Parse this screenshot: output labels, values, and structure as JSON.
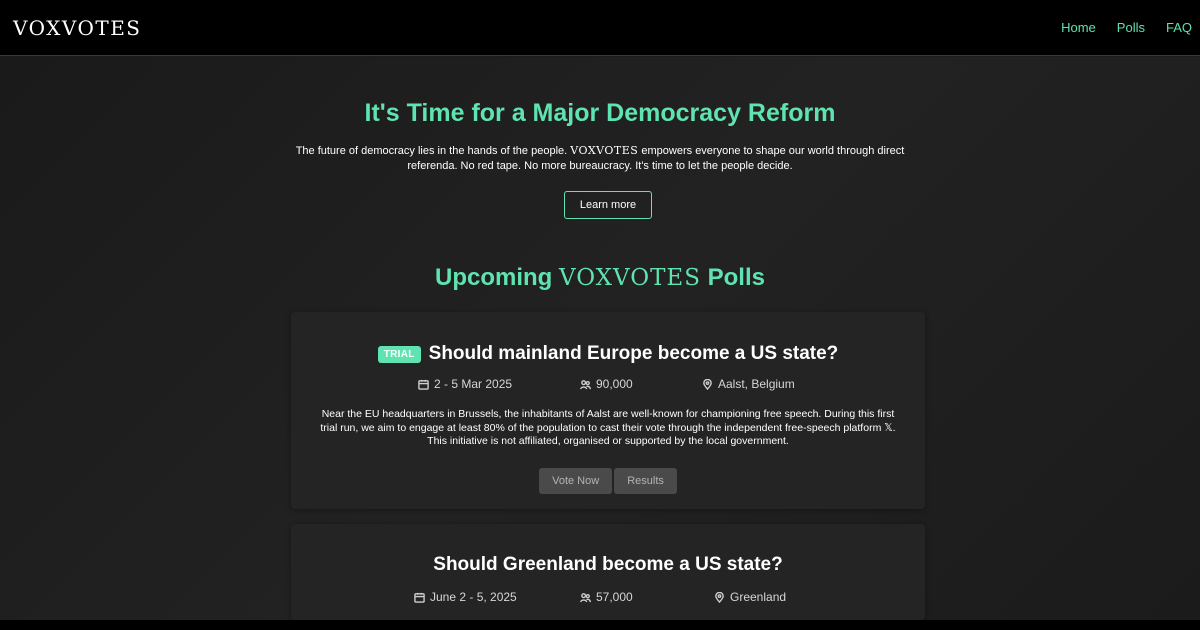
{
  "nav": {
    "brand": "VOXVOTES",
    "links": [
      "Home",
      "Polls",
      "FAQ"
    ]
  },
  "hero": {
    "title": "It's Time for a Major Democracy Reform",
    "text_before": "The future of democracy lies in the hands of the people.",
    "brand": "VOXVOTES",
    "text_after": "empowers everyone to shape our world through direct referenda. No red tape. No more bureaucracy. It's time to let the people decide.",
    "button": "Learn more"
  },
  "polls_section": {
    "title_before": "Upcoming",
    "brand": "VOXVOTES",
    "title_after": "Polls"
  },
  "polls": [
    {
      "badge": "TRIAL",
      "title": "Should mainland Europe become a US state?",
      "date": "2 - 5 Mar 2025",
      "participants": "90,000",
      "location": "Aalst, Belgium",
      "description": "Near the EU headquarters in Brussels, the inhabitants of Aalst are well-known for championing free speech. During this first trial run, we aim to engage at least 80% of the population to cast their vote through the independent free-speech platform 𝕏. This initiative is not affiliated, organised or supported by the local government.",
      "vote_label": "Vote Now",
      "results_label": "Results"
    },
    {
      "title": "Should Greenland become a US state?",
      "date": "June 2 - 5, 2025",
      "participants": "57,000",
      "location": "Greenland"
    }
  ],
  "colors": {
    "accent": "#5fe3b0",
    "background": "#1c1c1c",
    "navbar": "#000000",
    "card": "#242424"
  },
  "icons": {
    "date": "calendar-icon",
    "participants": "people-icon",
    "location": "location-pin-icon"
  }
}
